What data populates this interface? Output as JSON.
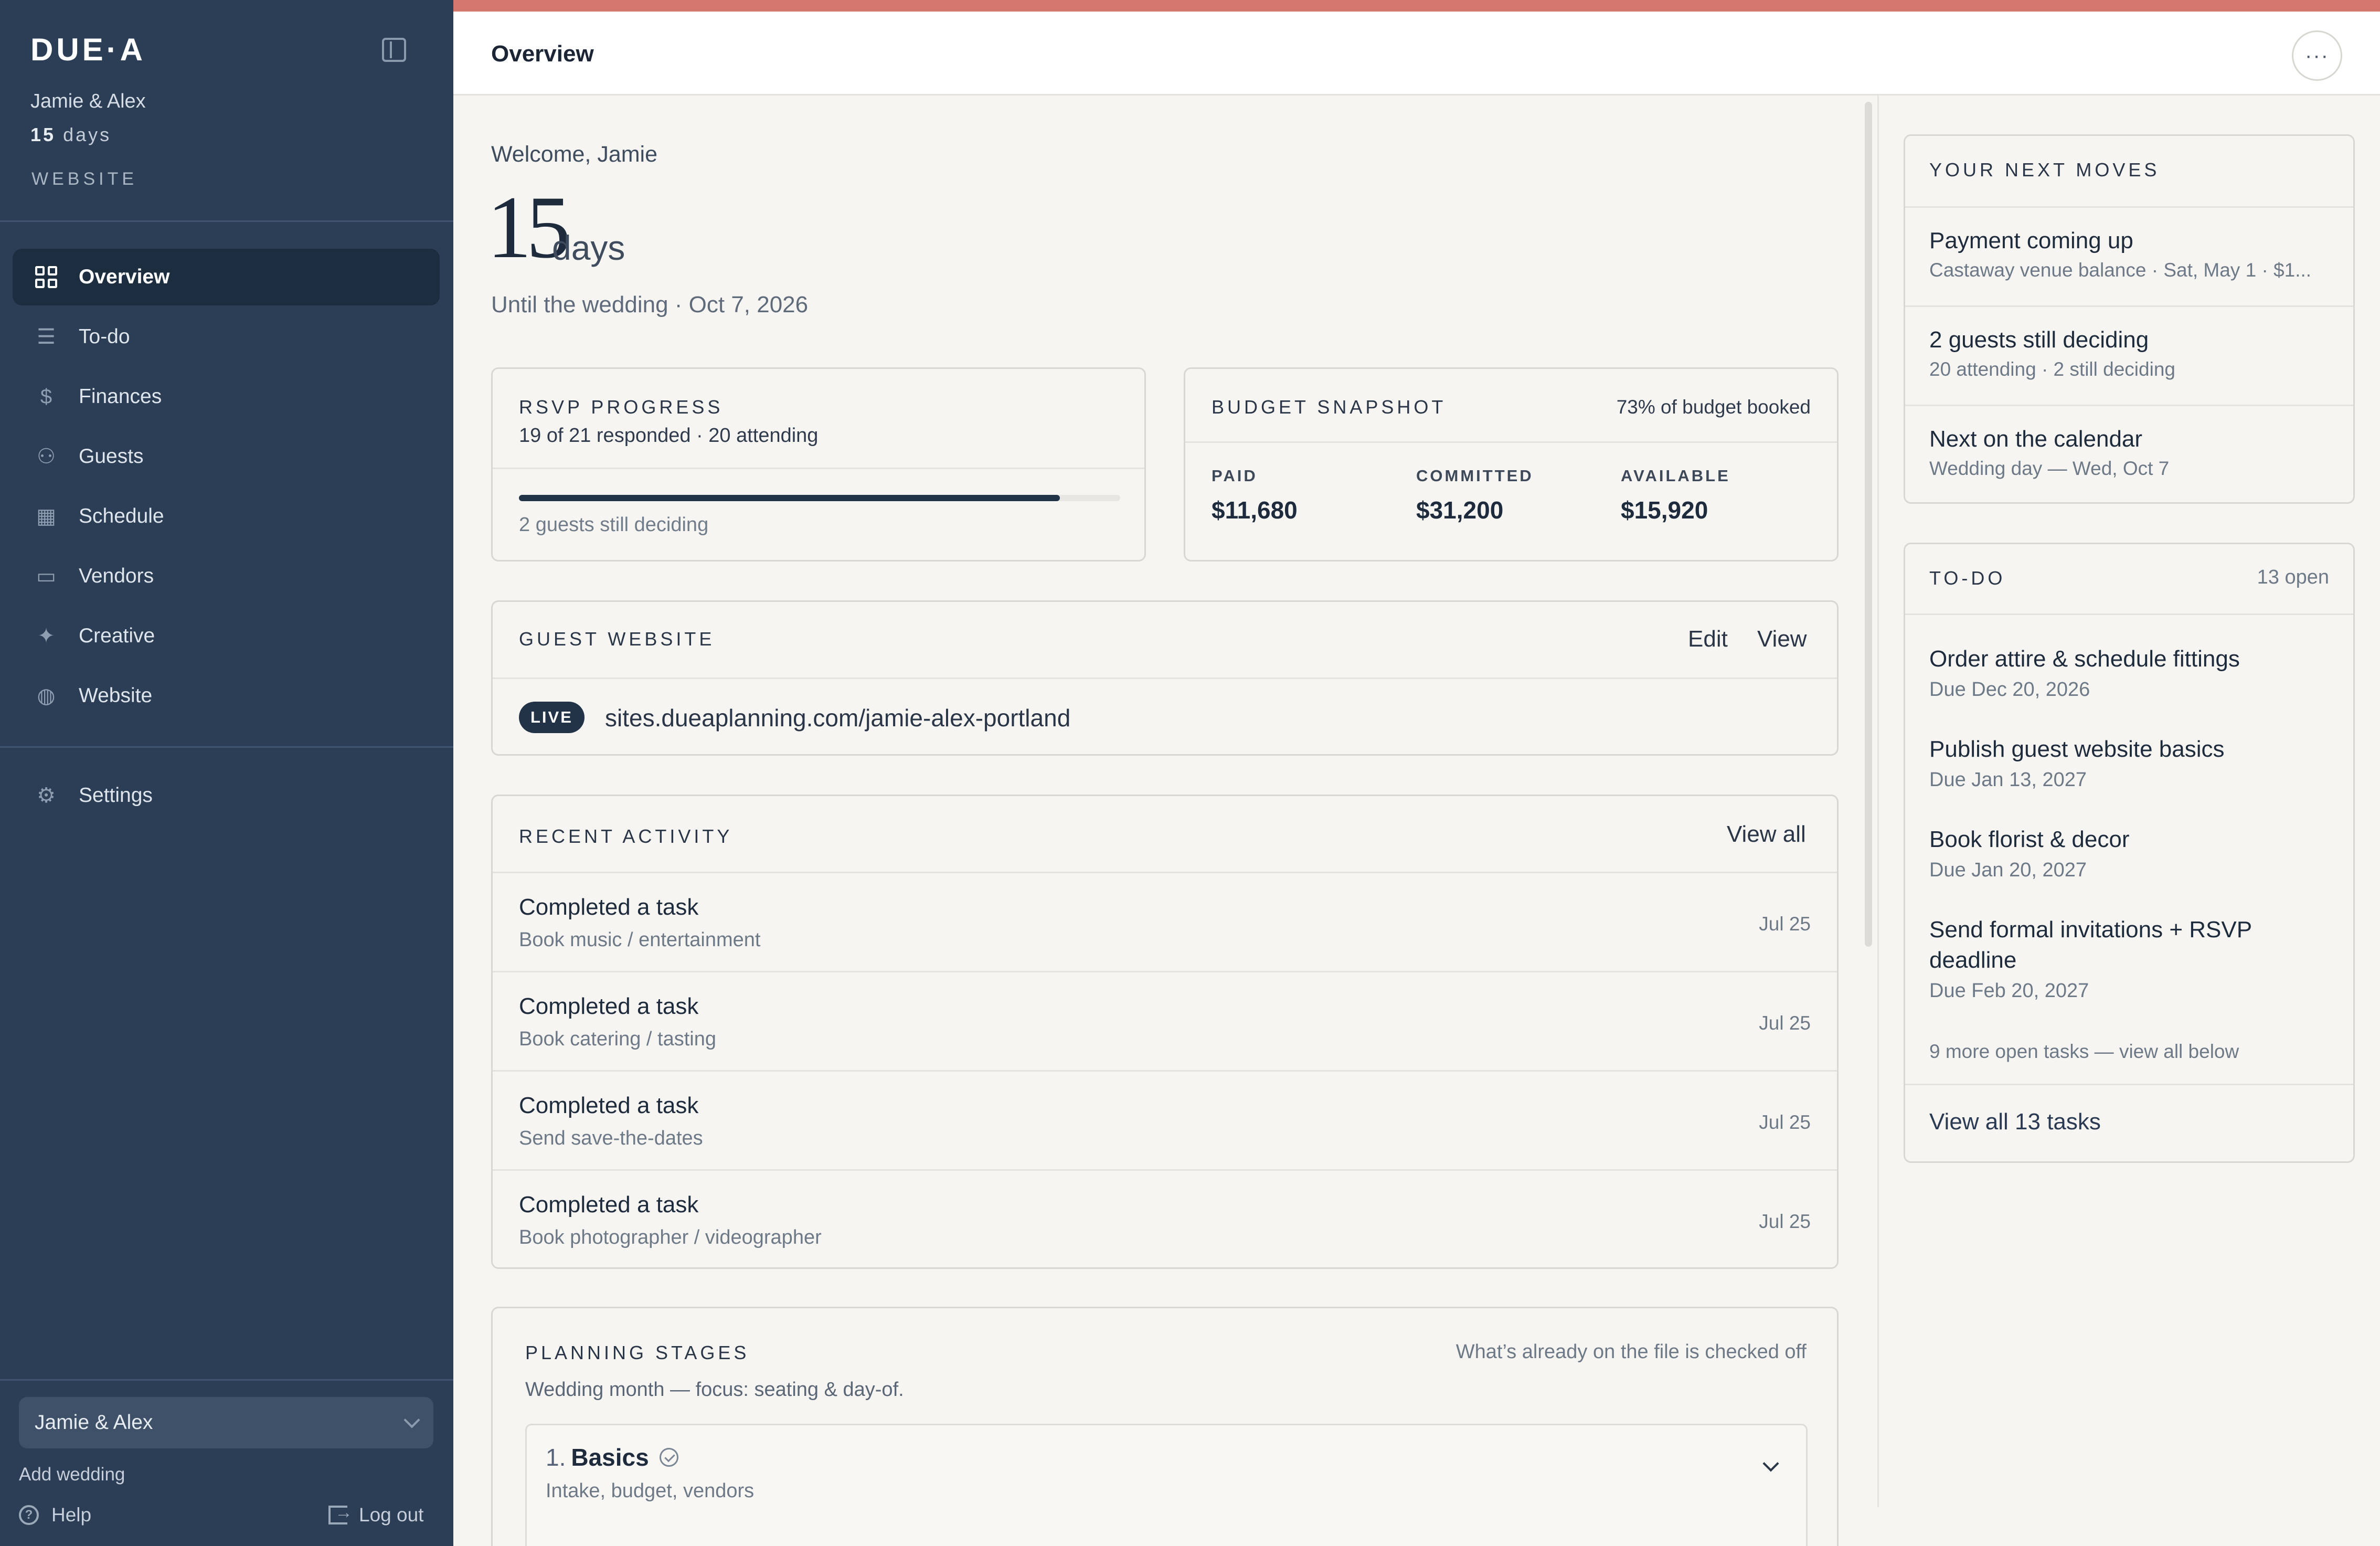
{
  "sidebar": {
    "logo": "DUE·A",
    "couple": "Jamie & Alex",
    "days_num": "15",
    "days_word": "days",
    "website": "WEBSITE",
    "nav": [
      {
        "label": "Overview",
        "icon": "grid-icon"
      },
      {
        "label": "To-do",
        "icon": "checklist-icon"
      },
      {
        "label": "Finances",
        "icon": "dollar-icon"
      },
      {
        "label": "Guests",
        "icon": "users-icon"
      },
      {
        "label": "Schedule",
        "icon": "calendar-icon"
      },
      {
        "label": "Vendors",
        "icon": "briefcase-icon"
      },
      {
        "label": "Creative",
        "icon": "sparkle-icon"
      },
      {
        "label": "Website",
        "icon": "globe-icon"
      }
    ],
    "settings": "Settings",
    "wedding_select": "Jamie & Alex",
    "add_wedding": "Add wedding",
    "help": "Help",
    "logout": "Log out"
  },
  "header": {
    "title": "Overview",
    "more": "···"
  },
  "hero": {
    "welcome": "Welcome, Jamie",
    "days_num": "15",
    "days_word": "days",
    "until": "Until the wedding · Oct 7, 2026"
  },
  "rsvp": {
    "label": "RSVP PROGRESS",
    "sub": "19 of 21 responded · 20 attending",
    "progress": 0.9,
    "foot": "2 guests still deciding"
  },
  "budget": {
    "label": "BUDGET SNAPSHOT",
    "booked": "73% of budget booked",
    "stats": [
      {
        "k": "PAID",
        "v": "$11,680"
      },
      {
        "k": "COMMITTED",
        "v": "$31,200"
      },
      {
        "k": "AVAILABLE",
        "v": "$15,920"
      }
    ]
  },
  "website": {
    "label": "GUEST WEBSITE",
    "edit": "Edit",
    "view": "View",
    "badge": "LIVE",
    "url": "sites.dueaplanning.com/jamie-alex-portland"
  },
  "activity": {
    "label": "RECENT ACTIVITY",
    "view_all": "View all",
    "rows": [
      {
        "title": "Completed a task",
        "sub": "Book music / entertainment",
        "date": "Jul 25"
      },
      {
        "title": "Completed a task",
        "sub": "Book catering / tasting",
        "date": "Jul 25"
      },
      {
        "title": "Completed a task",
        "sub": "Send save-the-dates",
        "date": "Jul 25"
      },
      {
        "title": "Completed a task",
        "sub": "Book photographer / videographer",
        "date": "Jul 25"
      }
    ]
  },
  "stages": {
    "label": "PLANNING STAGES",
    "note": "What’s already on the file is checked off",
    "focus": "Wedding month — focus: seating & day-of.",
    "first": {
      "num": "1.",
      "title": "Basics",
      "sub": "Intake, budget, vendors"
    }
  },
  "moves": {
    "label": "YOUR NEXT MOVES",
    "items": [
      {
        "title": "Payment coming up",
        "sub": "Castaway venue balance · Sat, May 1 · $1..."
      },
      {
        "title": "2 guests still deciding",
        "sub": "20 attending · 2 still deciding"
      },
      {
        "title": "Next on the calendar",
        "sub": "Wedding day — Wed, Oct 7"
      }
    ]
  },
  "todo": {
    "label": "TO-DO",
    "count": "13 open",
    "tasks": [
      {
        "title": "Order attire & schedule fittings",
        "due": "Due Dec 20, 2026"
      },
      {
        "title": "Publish guest website basics",
        "due": "Due Jan 13, 2027"
      },
      {
        "title": "Book florist & decor",
        "due": "Due Jan 20, 2027"
      },
      {
        "title": "Send formal invitations + RSVP deadline",
        "due": "Due Feb 20, 2027"
      }
    ],
    "more": "9 more open tasks — view all below",
    "view_all": "View all 13 tasks"
  },
  "colors": {
    "sidebar_bg": "#2b3e55",
    "accent_strip": "#d4786f",
    "background": "#f6f5f2",
    "ink": "#1e2b3c"
  }
}
